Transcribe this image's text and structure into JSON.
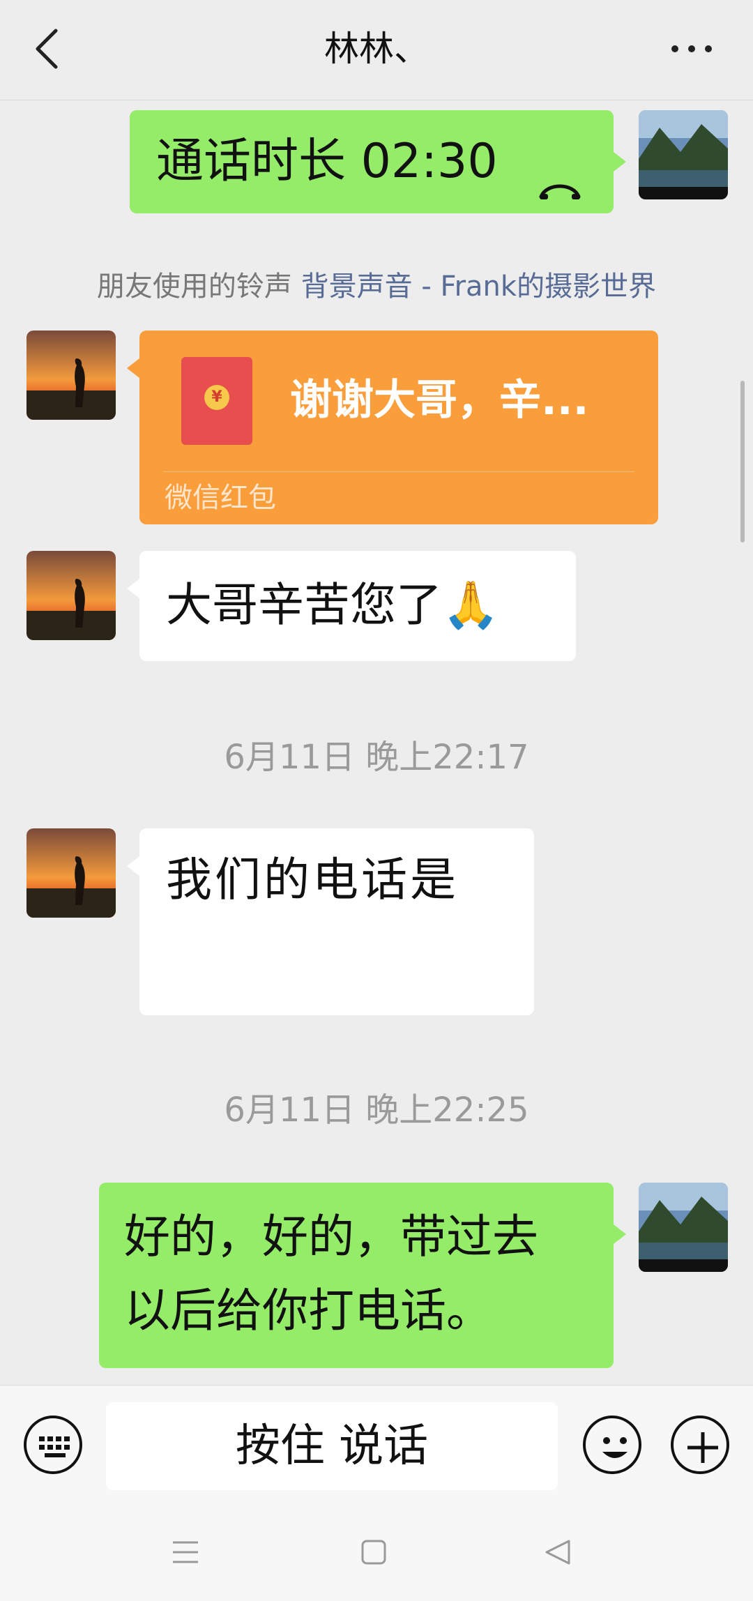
{
  "header": {
    "title": "林林、"
  },
  "messages": {
    "call": {
      "text": "通话时长 02:30"
    },
    "system_note": {
      "prefix": "朋友使用的铃声 ",
      "link": "背景声音 - Frank的摄影世界"
    },
    "red_packet": {
      "greeting": "谢谢大哥，辛...",
      "label": "微信红包",
      "coin_symbol": "¥"
    },
    "thanks": {
      "text": "大哥辛苦您了",
      "emoji": "🙏"
    },
    "timestamp1": "6月11日 晚上22:17",
    "phone": {
      "text": "我们的电话是"
    },
    "timestamp2": "6月11日 晚上22:25",
    "reply": {
      "line1": "好的，好的，带过去",
      "line2": "以后给你打电话。"
    }
  },
  "input_bar": {
    "hold_to_talk": "按住 说话"
  },
  "icons": [
    "back-arrow-icon",
    "more-icon",
    "phone-hangup-icon",
    "red-envelope-icon",
    "keyboard-icon",
    "emoji-icon",
    "plus-icon",
    "menu-icon",
    "home-icon",
    "back-triangle-icon"
  ],
  "colors": {
    "sent_bubble": "#95ec69",
    "received_bubble": "#ffffff",
    "red_packet": "#fa9d3b",
    "link": "#576b95",
    "background": "#ededed"
  }
}
